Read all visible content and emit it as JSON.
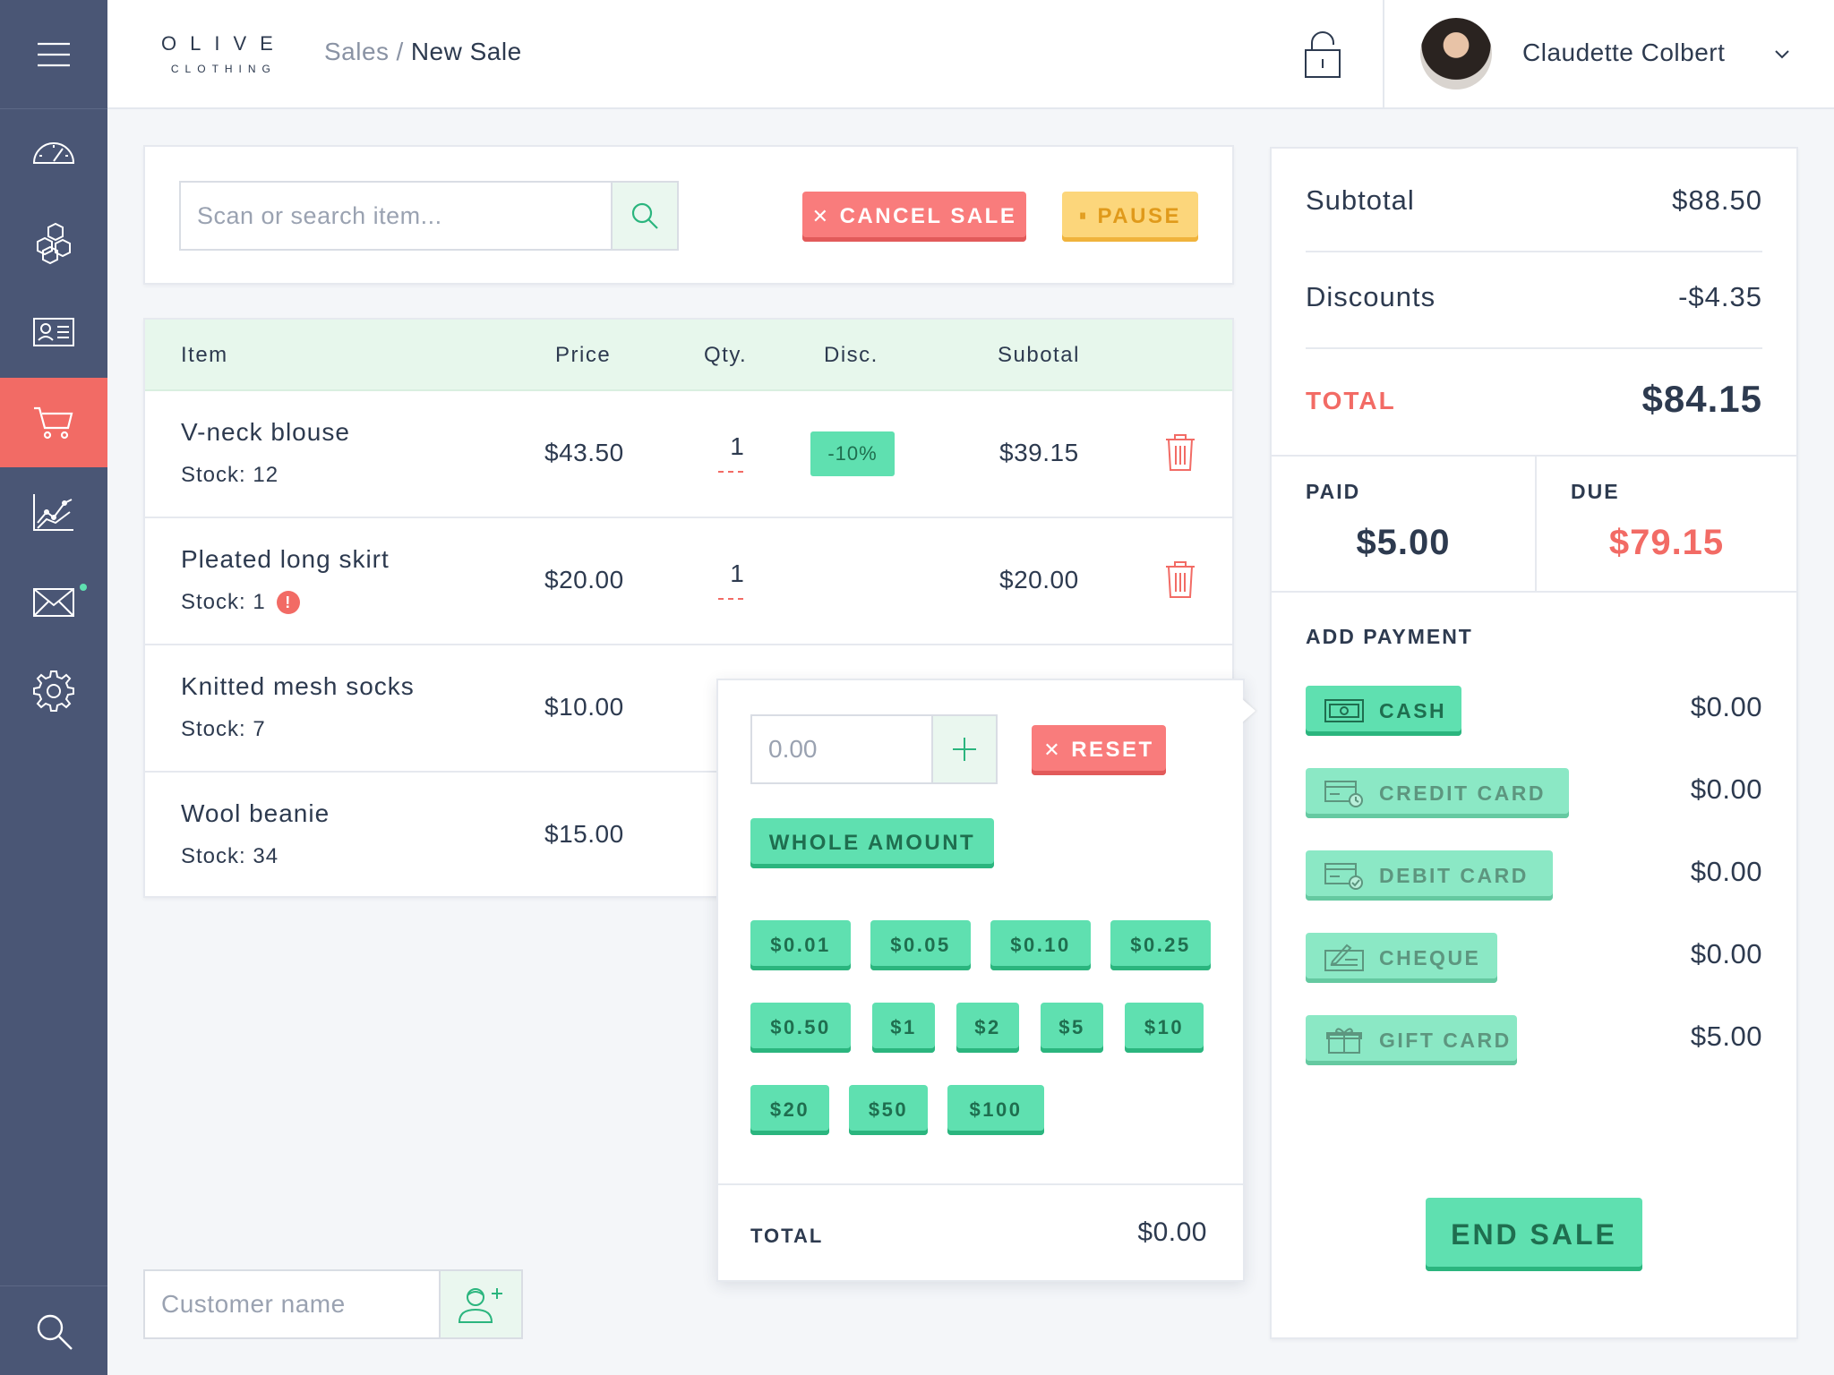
{
  "app": {
    "logo_main": "OLIVE",
    "logo_sub": "CLOTHING"
  },
  "header": {
    "breadcrumb_parent": "Sales",
    "breadcrumb_separator": "/",
    "breadcrumb_current": "New Sale",
    "user_name": "Claudette Colbert"
  },
  "sidebar": {
    "items": [
      "menu-icon",
      "dashboard-icon",
      "inventory-icon",
      "customers-icon",
      "sales-cart-icon",
      "reports-icon",
      "messages-icon",
      "settings-icon",
      "search-icon"
    ],
    "active": "sales-cart-icon",
    "accent_color": "#f26b65"
  },
  "search": {
    "placeholder": "Scan or search item...",
    "cancel_label": "CANCEL SALE",
    "cancel_icon": "✕",
    "pause_label": "PAUSE",
    "pause_icon": "⏸"
  },
  "table": {
    "headers": {
      "item": "Item",
      "price": "Price",
      "qty": "Qty.",
      "disc": "Disc.",
      "subtotal": "Subotal"
    },
    "rows": [
      {
        "name": "V-neck blouse",
        "stock": "Stock: 12",
        "price": "$43.50",
        "qty": "1",
        "disc": "-10%",
        "subtotal": "$39.15"
      },
      {
        "name": "Pleated long skirt",
        "stock": "Stock: 1",
        "warning": "!",
        "price": "$20.00",
        "qty": "1",
        "disc": "",
        "subtotal": "$20.00"
      },
      {
        "name": "Knitted mesh socks",
        "stock": "Stock: 7",
        "price": "$10.00"
      },
      {
        "name": "Wool beanie",
        "stock": "Stock: 34",
        "price": "$15.00"
      }
    ]
  },
  "popup": {
    "amount_placeholder": "0.00",
    "reset_label": "RESET",
    "reset_icon": "✕",
    "whole_amount_label": "WHOLE AMOUNT",
    "quick_amounts": [
      [
        "$0.01",
        "$0.05",
        "$0.10",
        "$0.25"
      ],
      [
        "$0.50",
        "$1",
        "$2",
        "$5",
        "$10"
      ],
      [
        "$20",
        "$50",
        "$100"
      ]
    ],
    "total_label": "TOTAL",
    "total_value": "$0.00"
  },
  "customer": {
    "placeholder": "Customer name"
  },
  "summary": {
    "subtotal_label": "Subtotal",
    "subtotal_value": "$88.50",
    "discounts_label": "Discounts",
    "discounts_value": "-$4.35",
    "total_label": "TOTAL",
    "total_value": "$84.15",
    "paid_label": "PAID",
    "paid_value": "$5.00",
    "due_label": "DUE",
    "due_value": "$79.15",
    "add_payment_label": "ADD PAYMENT",
    "payments": [
      {
        "label": "CASH",
        "amount": "$0.00",
        "icon": "cash-icon"
      },
      {
        "label": "CREDIT CARD",
        "amount": "$0.00",
        "icon": "credit-card-icon"
      },
      {
        "label": "DEBIT CARD",
        "amount": "$0.00",
        "icon": "debit-card-icon"
      },
      {
        "label": "CHEQUE",
        "amount": "$0.00",
        "icon": "cheque-icon"
      },
      {
        "label": "GIFT CARD",
        "amount": "$5.00",
        "icon": "gift-card-icon"
      }
    ],
    "end_sale_label": "END SALE"
  }
}
